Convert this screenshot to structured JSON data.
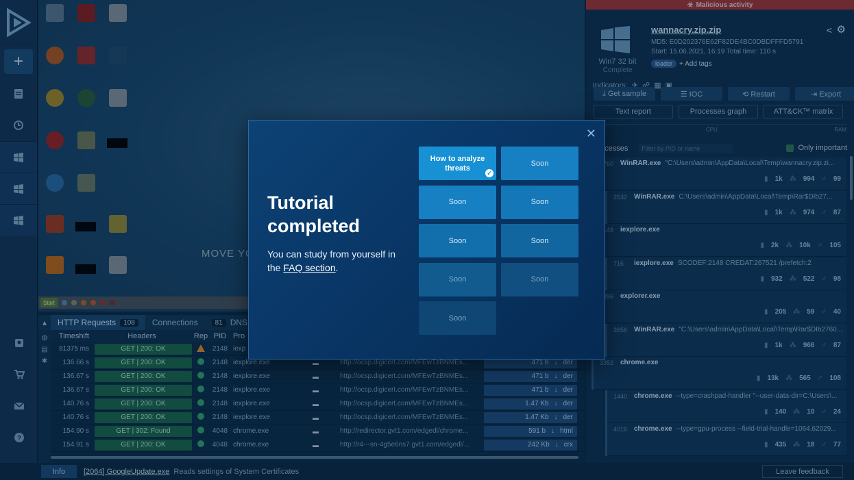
{
  "right": {
    "status_banner": "Malicious activity",
    "file_name": "wannacry.zip.zip",
    "md5": "MD5: E0D202376E62F82DE4BC0DBDFFFD5791",
    "start": "Start: 15.06.2021, 16:19     Total time: 110 s",
    "os_name": "Win7 32 bit",
    "os_status": "Complete",
    "tag": "loader",
    "add_tags": "+ Add tags",
    "indicators_label": "Indicators:",
    "get_sample": "⤓ Get sample",
    "ioc": "☰ IOC",
    "restart": "⟲ Restart",
    "export": "⇥ Export",
    "text_report": "Text report",
    "processes_graph": "Processes graph",
    "attack_matrix": "ATT&CK™ matrix",
    "cpu": "CPU",
    "ram": "RAM",
    "processes_label": "Processes",
    "filter_placeholder": "Filter by PID or name",
    "only_important": "Only important",
    "processes": [
      {
        "pid": "2760",
        "name": "WinRAR.exe",
        "cmd": "\"C:\\Users\\admin\\AppData\\Local\\Temp\\wannacry.zip.zi...",
        "files": "1k",
        "reg": "994",
        "net": "99"
      },
      {
        "pid": "2532",
        "name": "WinRAR.exe",
        "cmd": "C:\\Users\\admin\\AppData\\Local\\Temp\\Rar$DIb27...",
        "files": "1k",
        "reg": "974",
        "net": "87"
      },
      {
        "pid": "2148",
        "name": "iexplore.exe",
        "cmd": "",
        "files": "2k",
        "reg": "10k",
        "net": "105"
      },
      {
        "pid": "716",
        "name": "iexplore.exe",
        "cmd": "SCODEF:2148 CREDAT:267521 /prefetch:2",
        "files": "932",
        "reg": "522",
        "net": "98"
      },
      {
        "pid": "2396",
        "name": "explorer.exe",
        "cmd": "",
        "files": "205",
        "reg": "59",
        "net": "40"
      },
      {
        "pid": "3656",
        "name": "WinRAR.exe",
        "cmd": "\"C:\\Users\\admin\\AppData\\Local\\Temp\\Rar$DIb2760...",
        "files": "1k",
        "reg": "966",
        "net": "87"
      },
      {
        "pid": "3352",
        "name": "chrome.exe",
        "cmd": "",
        "files": "13k",
        "reg": "565",
        "net": "108"
      },
      {
        "pid": "1440",
        "name": "chrome.exe",
        "cmd": "--type=crashpad-handler \"--user-data-dir=C:\\Users\\...",
        "files": "140",
        "reg": "10",
        "net": "24"
      },
      {
        "pid": "4016",
        "name": "chrome.exe",
        "cmd": "--type=gpu-process --field-trial-handle=1064,62029...",
        "files": "435",
        "reg": "18",
        "net": "77"
      }
    ]
  },
  "bottom": {
    "tab_http": "HTTP Requests",
    "tab_http_count": "108",
    "tab_conn": "Connections",
    "tab_conn_count": "81",
    "tab_dns": "DNS Requ",
    "col_time": "Timeshift",
    "col_headers": "Headers",
    "col_rep": "Rep",
    "col_pid": "PID",
    "col_proc": "Pro",
    "rows": [
      {
        "time": "81375 ms",
        "hd": "GET  |  200: OK",
        "rep": "warn",
        "pid": "2148",
        "proc": "iexp",
        "url": "",
        "size": "",
        "type": ""
      },
      {
        "time": "136.66 s",
        "hd": "GET  |  200: OK",
        "rep": "ok",
        "pid": "2148",
        "proc": "iexplore.exe",
        "url": "http://ocsp.digicert.com/MFEwTzBNMEs...",
        "size": "471 b",
        "type": "der"
      },
      {
        "time": "136.67 s",
        "hd": "GET  |  200: OK",
        "rep": "ok",
        "pid": "2148",
        "proc": "iexplore.exe",
        "url": "http://ocsp.digicert.com/MFEwTzBNMEs...",
        "size": "471 b",
        "type": "der"
      },
      {
        "time": "136.67 s",
        "hd": "GET  |  200: OK",
        "rep": "ok",
        "pid": "2148",
        "proc": "iexplore.exe",
        "url": "http://ocsp.digicert.com/MFEwTzBNMEs...",
        "size": "471 b",
        "type": "der"
      },
      {
        "time": "140.76 s",
        "hd": "GET  |  200: OK",
        "rep": "ok",
        "pid": "2148",
        "proc": "iexplore.exe",
        "url": "http://ocsp.digicert.com/MFEwTzBNMEs...",
        "size": "1.47 Kb",
        "type": "der"
      },
      {
        "time": "140.76 s",
        "hd": "GET  |  200: OK",
        "rep": "ok",
        "pid": "2148",
        "proc": "iexplore.exe",
        "url": "http://ocsp.digicert.com/MFEwTzBNMEs...",
        "size": "1.47 Kb",
        "type": "der"
      },
      {
        "time": "154.90 s",
        "hd": "GET  |  302: Found",
        "rep": "ok",
        "pid": "4048",
        "proc": "chrome.exe",
        "url": "http://redirector.gvt1.com/edgedl/chrome...",
        "size": "591 b",
        "type": "html"
      },
      {
        "time": "154.91 s",
        "hd": "GET  |  200: OK",
        "rep": "ok",
        "pid": "4048",
        "proc": "chrome.exe",
        "url": "http://r4---sn-4g5e6ns7.gvt1.com/edgedl/...",
        "size": "242 Kb",
        "type": "crx"
      }
    ]
  },
  "status": {
    "info": "Info",
    "proc": "[2064] GoogleUpdate.exe",
    "msg": "Reads settings of System Certificates",
    "feedback": "Leave feedback"
  },
  "desktop": {
    "move_text": "MOVE YO",
    "start": "Start"
  },
  "modal": {
    "title": "Tutorial completed",
    "text_before": "You can study from yourself in the ",
    "link": "FAQ section",
    "text_after": ".",
    "items": [
      {
        "label": "How to analyze threats",
        "state": "done"
      },
      {
        "label": "Soon",
        "state": "soon"
      },
      {
        "label": "Soon",
        "state": "soon"
      },
      {
        "label": "Soon",
        "state": "soon"
      },
      {
        "label": "Soon",
        "state": "soon"
      },
      {
        "label": "Soon",
        "state": "soon"
      },
      {
        "label": "Soon",
        "state": "soon"
      },
      {
        "label": "Soon",
        "state": "soon"
      },
      {
        "label": "Soon",
        "state": "soon"
      }
    ]
  },
  "colors": {
    "accent": "#1791d4",
    "malicious": "#a8363a",
    "ok": "#35a672",
    "warn": "#e0902a"
  }
}
